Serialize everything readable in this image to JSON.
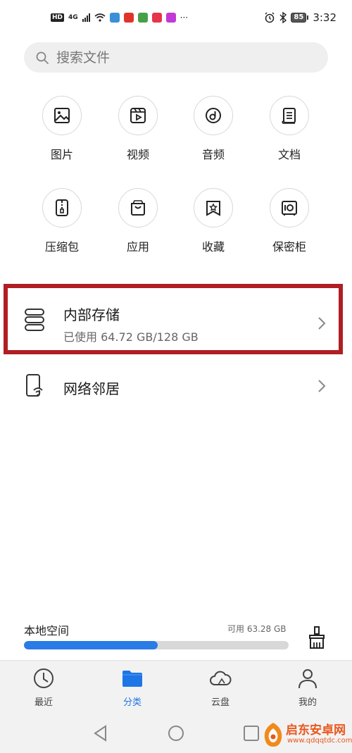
{
  "status_bar": {
    "hd": "HD",
    "net": "4G",
    "time": "3:32",
    "battery": "85"
  },
  "search": {
    "placeholder": "搜索文件"
  },
  "categories": [
    {
      "label": "图片",
      "icon": "image-icon"
    },
    {
      "label": "视频",
      "icon": "video-icon"
    },
    {
      "label": "音频",
      "icon": "audio-icon"
    },
    {
      "label": "文档",
      "icon": "document-icon"
    },
    {
      "label": "压缩包",
      "icon": "archive-icon"
    },
    {
      "label": "应用",
      "icon": "app-bag-icon"
    },
    {
      "label": "收藏",
      "icon": "favorite-icon"
    },
    {
      "label": "保密柜",
      "icon": "safe-icon"
    }
  ],
  "internal_storage": {
    "title": "内部存储",
    "usage": "已使用 64.72 GB/128 GB",
    "highlight_color": "#b01e23"
  },
  "network": {
    "title": "网络邻居"
  },
  "local_space": {
    "label": "本地空间",
    "available": "可用 63.28 GB",
    "used_fraction": 0.506,
    "bar_color": "#2b7be6"
  },
  "tabs": [
    {
      "label": "最近",
      "icon": "clock-icon",
      "active": false
    },
    {
      "label": "分类",
      "icon": "folder-icon",
      "active": true
    },
    {
      "label": "云盘",
      "icon": "cloud-icon",
      "active": false
    },
    {
      "label": "我的",
      "icon": "person-icon",
      "active": false
    }
  ],
  "watermark": {
    "title": "启东安卓网",
    "url": "www.qdqqtdc.com"
  },
  "colors": {
    "accent": "#1e75e6"
  }
}
